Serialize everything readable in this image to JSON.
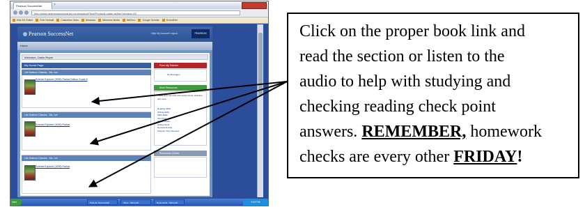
{
  "browser": {
    "tab_title": "Pearson SuccessNet",
    "url": "http://www.pearsonsuccessnet.com/snpapp/iText/ProductLoader.action?section=20",
    "bookmarks": [
      "Kids Ed Online",
      "Free Hotmail",
      "Customize Links",
      "Windows",
      "Windows Media",
      "NetZero",
      "Google Scholar",
      "SchoolNet"
    ],
    "taskbar": {
      "start_label": "start",
      "tasks": [
        "Pearson SuccessNet",
        "Inbox - Microsoft",
        "Document1 - Microsoft"
      ],
      "clock": "9:42 PM"
    }
  },
  "page": {
    "logo": "Pearson SuccessNet",
    "header_links": "Help  My Account  Logout",
    "publisher_badge": "PEARSON",
    "menu_home": "Home",
    "welcome": "Welcome, Darlin Roper",
    "main_panel_title": "My Home Page",
    "classes": [
      {
        "title": "Life Science Classes - Ms. Lee",
        "book_link": "Science Explorer (2009) Florida Edition Grade 8"
      },
      {
        "title": "Life Science Classes - Ms. Lee",
        "book_link": "Science Explorer (2009) Florida"
      },
      {
        "title": "Life Science Classes - Ms. Lee",
        "book_link": "Science Explorer (2009) Florida"
      }
    ],
    "sidebar": {
      "from_teacher": "From My Teacher",
      "from_teacher_item": "No Messages",
      "resources_title": "More Resources",
      "resources_intro": "These links can help with assignments, activities, and more.",
      "resources_links": [
        "Reading Skills",
        "Writing Skills",
        "Math Skills",
        "Test Prep",
        "Study Guides",
        "Writing Tools",
        "Homework Help"
      ],
      "resources_footer": "Pearson Tutor Services",
      "research_title": "Resources Center"
    }
  },
  "callout": {
    "line1": "Click on the proper book link and",
    "line2": "read the section or listen to the",
    "line3": "audio to help with studying and",
    "line4": "checking reading check point",
    "line5_a": "answers. ",
    "line5_em": "REMEMBER,",
    "line5_b": " homework",
    "line6_a": "checks are every other ",
    "line6_em": "FRIDAY",
    "line6_b": "!"
  }
}
